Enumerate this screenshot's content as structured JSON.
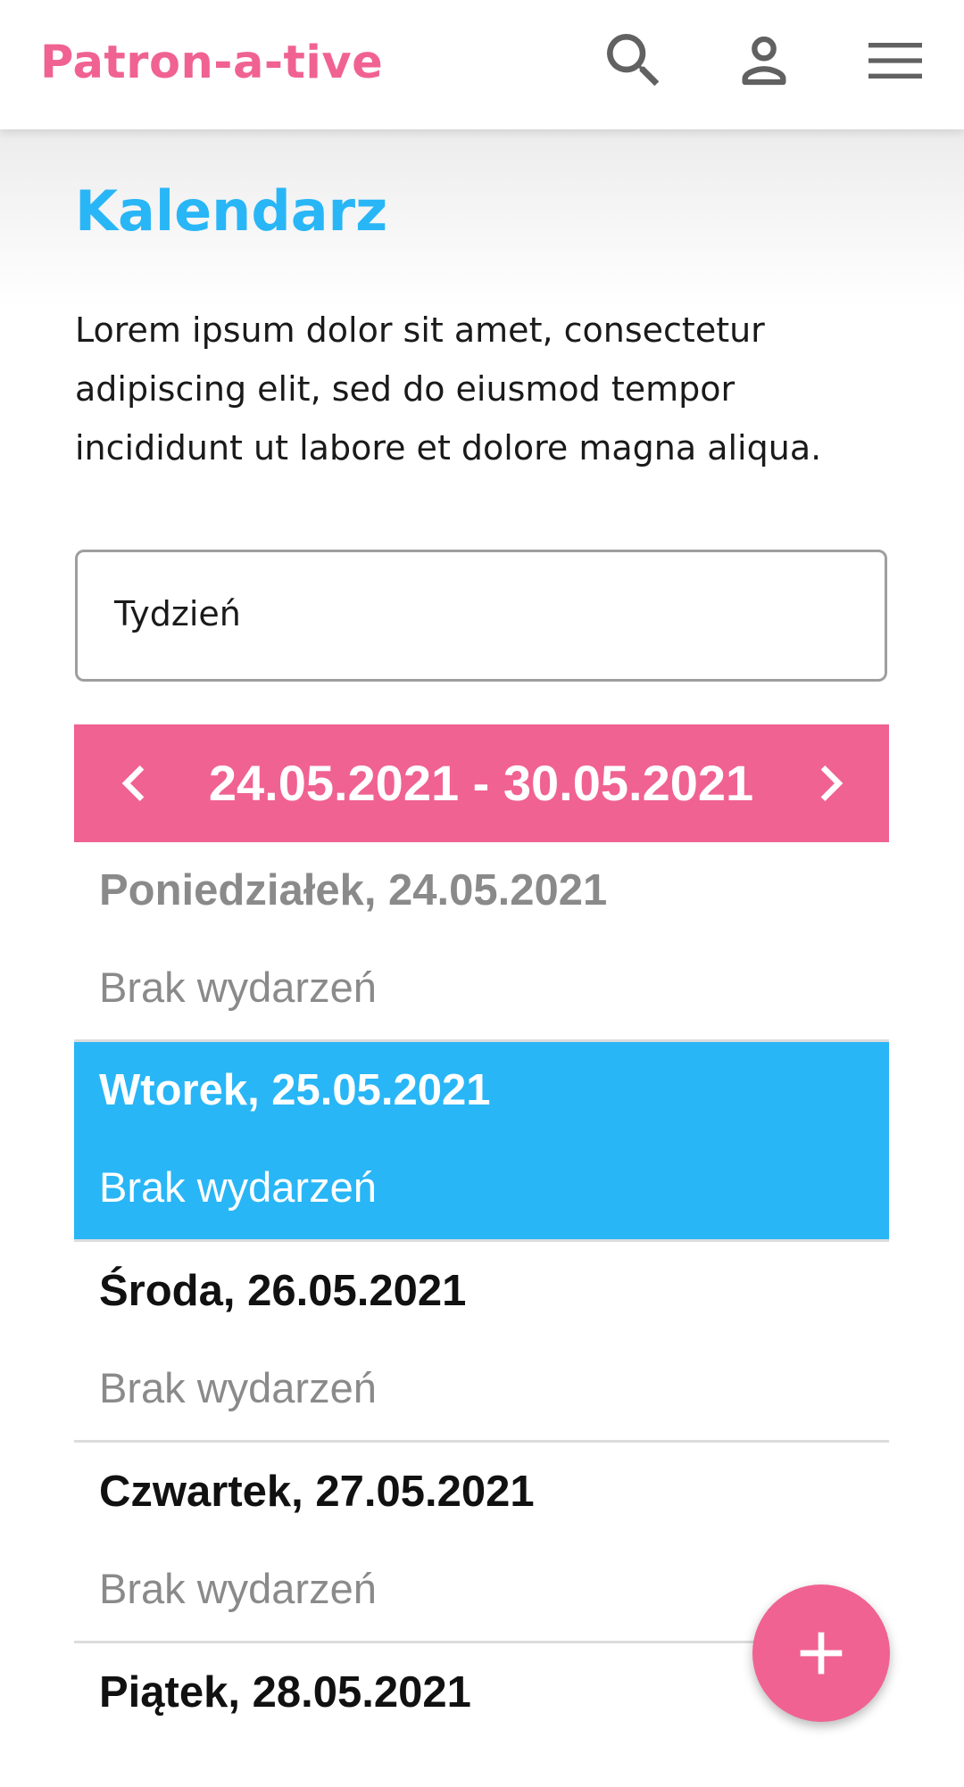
{
  "header": {
    "brand": "Patron-a-tive",
    "icons": [
      "search-icon",
      "account-icon",
      "menu-icon"
    ]
  },
  "page": {
    "title": "Kalendarz",
    "intro": "Lorem ipsum dolor sit amet, consectetur adipiscing elit, sed do eiusmod tempor incididunt ut labore et dolore magna aliqua."
  },
  "view_select": {
    "value": "Tydzień"
  },
  "week": {
    "range": "24.05.2021 - 30.05.2021"
  },
  "days": [
    {
      "title": "Poniedziałek, 24.05.2021",
      "events": "Brak wydarzeń",
      "state": "past"
    },
    {
      "title": "Wtorek, 25.05.2021",
      "events": "Brak wydarzeń",
      "state": "today"
    },
    {
      "title": "Środa, 26.05.2021",
      "events": "Brak wydarzeń",
      "state": "upcoming"
    },
    {
      "title": "Czwartek, 27.05.2021",
      "events": "Brak wydarzeń",
      "state": "upcoming"
    },
    {
      "title": "Piątek, 28.05.2021",
      "events": "",
      "state": "upcoming"
    }
  ],
  "colors": {
    "brand_pink": "#f06292",
    "accent_blue": "#29b6f6",
    "muted_text": "#8a8a8a"
  },
  "fab": {
    "icon": "plus-icon"
  }
}
